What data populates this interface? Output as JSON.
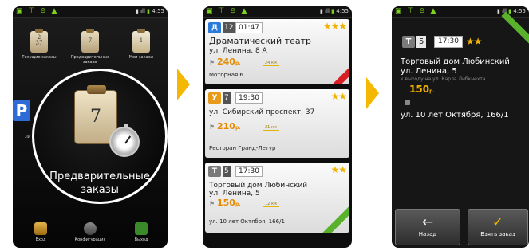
{
  "status_bar": {
    "time": "4:55",
    "time_2": "4:55",
    "time_3": "4:55"
  },
  "launcher": {
    "icons": [
      {
        "label": "Текущие заказы",
        "glyph": "2\n37"
      },
      {
        "label": "Предварительные заказы",
        "glyph": "7"
      },
      {
        "label": "Мои заказы",
        "glyph": "1"
      },
      {
        "label": "Вход"
      },
      {
        "label": "Конфигурация"
      },
      {
        "label": "Выход"
      }
    ],
    "magnified_label": "Предварительные заказы",
    "magnified_number": "7"
  },
  "orders": [
    {
      "class": "Д",
      "number": "12",
      "time": "01:47",
      "stars": "★★★",
      "address": "Драматический театр",
      "street": "ул. Ленина, 8 А",
      "price": "240",
      "currency": "р.",
      "distance": "24 км",
      "destination": "Моторная 6"
    },
    {
      "class": "У",
      "number": "7",
      "time": "19:30",
      "stars": "★★",
      "address": "ул. Сибирский проспект, 37",
      "street": "",
      "price": "210",
      "currency": "р.",
      "distance": "21 км",
      "destination": "Ресторан Гранд-Летур"
    },
    {
      "class": "Т",
      "number": "5",
      "time": "17:30",
      "stars": "★★",
      "address": "Торговый дом Любинский",
      "street": "ул. Ленина, 5",
      "price": "150",
      "currency": "р.",
      "distance": "12 км",
      "destination": "ул. 10 лет Октября, 166/1"
    }
  ],
  "detail": {
    "class": "Т",
    "number": "5",
    "time": "17:30",
    "stars": "★★",
    "address": "Торговый дом Любинский",
    "street": "ул. Ленина, 5",
    "hint": "к выходу на ул. Карла Либкнехта",
    "price": "150",
    "currency": "р.",
    "destination": "ул. 10 лет Октября, 166/1",
    "back_label": "Назад",
    "take_label": "Взять заказ"
  },
  "colors": {
    "accent": "#f5b800",
    "order_express": "#2a7bd8",
    "order_urgent": "#e89a1b",
    "order_regular": "#7a7a7a",
    "ribbon_green": "#5ab22c",
    "ribbon_red": "#d81f26"
  }
}
